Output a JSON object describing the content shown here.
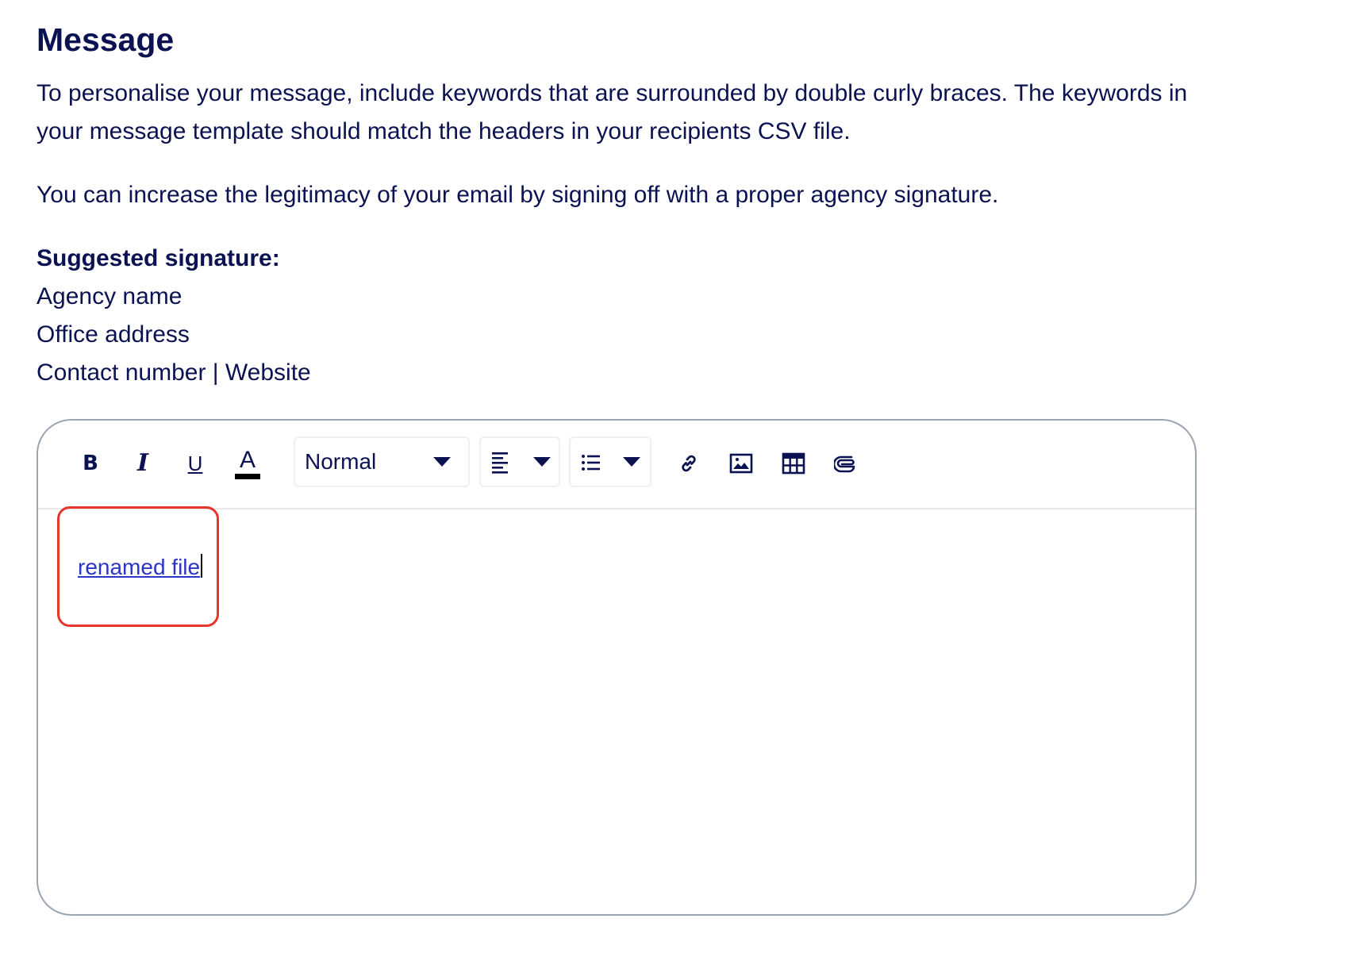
{
  "section": {
    "title": "Message",
    "intro": "To personalise your message, include keywords that are surrounded by double curly braces. The keywords in your message template should match the headers in your recipients CSV file.",
    "legitimacy": "You can increase the legitimacy of your email by signing off with a proper agency signature."
  },
  "signature": {
    "heading": "Suggested signature:",
    "lines": [
      "Agency name",
      "Office address",
      "Contact number | Website"
    ]
  },
  "toolbar": {
    "bold": "B",
    "italic": "I",
    "underline": "U",
    "text_color": "A",
    "text_color_value": "#000000",
    "format_select": "Normal",
    "icons": [
      "bold-icon",
      "italic-icon",
      "underline-icon",
      "text-color-icon",
      "align-left-icon",
      "bullet-list-icon",
      "link-icon",
      "image-icon",
      "table-icon",
      "attachment-icon"
    ]
  },
  "editor": {
    "content_link": "renamed file"
  },
  "colors": {
    "text": "#0b1252",
    "link": "#2b35c8",
    "highlight": "#e6352b",
    "editor_border": "#9aa4b0"
  }
}
